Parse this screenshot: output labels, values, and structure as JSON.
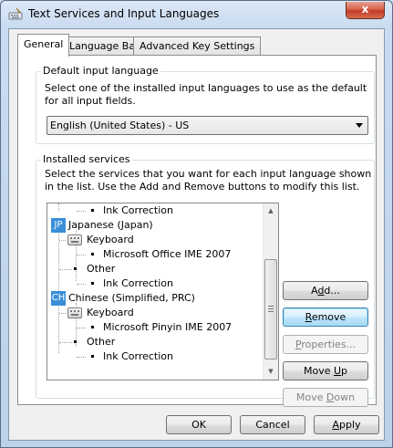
{
  "window": {
    "title": "Text Services and Input Languages",
    "close_glyph": "x"
  },
  "tabs": [
    {
      "label": "General"
    },
    {
      "label": "Language Bar"
    },
    {
      "label": "Advanced Key Settings"
    }
  ],
  "default_language": {
    "caption": "Default input language",
    "description": "Select one of the installed input languages to use as the default for all input fields.",
    "selected": "English (United States) - US"
  },
  "installed_services": {
    "caption": "Installed services",
    "description": "Select the services that you want for each input language shown in the list. Use the Add and Remove buttons to modify this list.",
    "tree": [
      {
        "text": "Ink Correction"
      },
      {
        "badge": "JP",
        "text": "Japanese (Japan)"
      },
      {
        "text": "Keyboard"
      },
      {
        "text": "Microsoft Office IME 2007"
      },
      {
        "text": "Other"
      },
      {
        "text": "Ink Correction"
      },
      {
        "badge": "CH",
        "text": "Chinese (Simplified, PRC)"
      },
      {
        "text": "Keyboard"
      },
      {
        "text": "Microsoft Pinyin IME 2007"
      },
      {
        "text": "Other"
      },
      {
        "text": "Ink Correction"
      }
    ],
    "buttons": {
      "add": {
        "pre": "A",
        "u": "d",
        "post": "d..."
      },
      "remove": {
        "pre": "",
        "u": "R",
        "post": "emove"
      },
      "properties": {
        "pre": "",
        "u": "P",
        "post": "roperties..."
      },
      "move_up": {
        "pre": "Move ",
        "u": "U",
        "post": "p"
      },
      "move_down": {
        "pre": "Move ",
        "u": "D",
        "post": "own"
      }
    }
  },
  "footer": {
    "ok": "OK",
    "cancel": "Cancel",
    "apply": {
      "pre": "",
      "u": "A",
      "post": "pply"
    }
  },
  "colors": {
    "badge": "#3b8fd9",
    "close_button": "#c9442c",
    "default_button_border": "#3c7fb1"
  }
}
